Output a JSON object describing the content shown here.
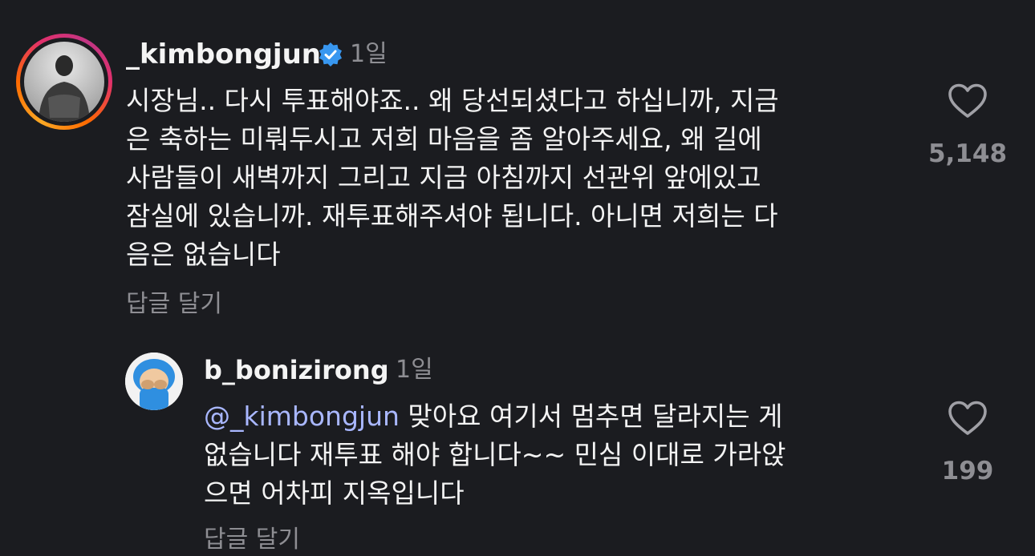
{
  "comments": [
    {
      "username": "_kimbongjun",
      "verified": true,
      "time": "1일",
      "lines": [
        "시장님.. 다시 투표해야죠.. 왜 당선되셨다고 하십니까, 지금",
        "은 축하는 미뤄두시고 저희 마음을 좀 알아주세요, 왜 길에",
        "사람들이 새벽까지 그리고 지금 아침까지 선관위 앞에있고",
        "잠실에 있습니까. 재투표해주셔야 됩니다. 아니면 저희는 다",
        "음은 없습니다"
      ],
      "reply_label": "답글 달기",
      "like_icon": "heart-outline-icon",
      "likes": "5,148"
    },
    {
      "username": "b_bonizirong",
      "verified": false,
      "time": "1일",
      "mention": "@_kimbongjun",
      "lines": [
        " 맞아요 여기서 멈추면 달라지는 게",
        "없습니다 재투표 해야 합니다~~ 민심 이대로 가라앉",
        "으면 어차피 지옥입니다"
      ],
      "reply_label": "답글 달기",
      "like_icon": "heart-outline-icon",
      "likes": "199"
    }
  ],
  "colors": {
    "background": "#1b1c20",
    "secondary_text": "#8e8e93",
    "mention": "#a9b7ff",
    "verified": "#3897f0"
  }
}
